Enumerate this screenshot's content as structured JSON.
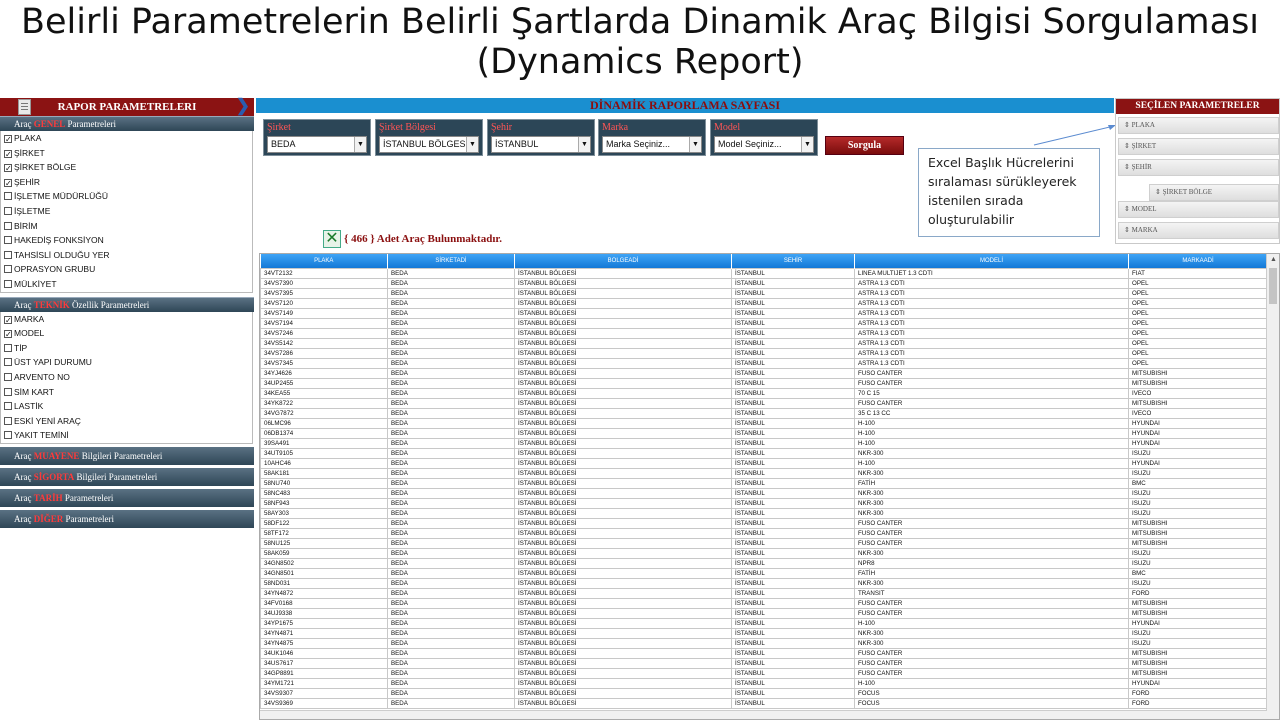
{
  "slide": {
    "title_line1": "Belirli Parametrelerin Belirli Şartlarda Dinamik Araç Bilgisi Sorgulaması",
    "title_line2": "(Dynamics Report)"
  },
  "sidebar": {
    "header": "RAPOR PARAMETRELERI",
    "sections": [
      {
        "prefix": "Araç",
        "highlight": "GENEL",
        "suffix": "Parametreleri",
        "items": [
          {
            "label": "PLAKA",
            "checked": true
          },
          {
            "label": "ŞİRKET",
            "checked": true
          },
          {
            "label": "ŞİRKET BÖLGE",
            "checked": true
          },
          {
            "label": "ŞEHİR",
            "checked": true
          },
          {
            "label": "İŞLETME MÜDÜRLÜĞÜ",
            "checked": false
          },
          {
            "label": "İŞLETME",
            "checked": false
          },
          {
            "label": "BİRİM",
            "checked": false
          },
          {
            "label": "HAKEDİŞ FONKSİYON",
            "checked": false
          },
          {
            "label": "TAHSİSLİ OLDUĞU YER",
            "checked": false
          },
          {
            "label": "OPRASYON GRUBU",
            "checked": false
          },
          {
            "label": "MÜLKİYET",
            "checked": false
          }
        ]
      },
      {
        "prefix": "Araç",
        "highlight": "TEKNİK",
        "suffix": "Özellik Parametreleri",
        "items": [
          {
            "label": "MARKA",
            "checked": true
          },
          {
            "label": "MODEL",
            "checked": true
          },
          {
            "label": "TİP",
            "checked": false
          },
          {
            "label": "ÜST YAPI DURUMU",
            "checked": false
          },
          {
            "label": "ARVENTO NO",
            "checked": false
          },
          {
            "label": "SİM KART",
            "checked": false
          },
          {
            "label": "LASTİK",
            "checked": false
          },
          {
            "label": "ESKİ YENİ ARAÇ",
            "checked": false
          },
          {
            "label": "YAKIT TEMİNİ",
            "checked": false
          }
        ]
      }
    ],
    "collapsed": [
      {
        "prefix": "Araç",
        "highlight": "MUAYENE",
        "suffix": "Bilgileri Parametreleri"
      },
      {
        "prefix": "Araç",
        "highlight": "SİGORTA",
        "suffix": "Bilgileri Parametreleri"
      },
      {
        "prefix": "Araç",
        "highlight": "TARİH",
        "suffix": "Parametreleri"
      },
      {
        "prefix": "Araç",
        "highlight": "DİĞER",
        "suffix": "Parametreleri"
      }
    ]
  },
  "main": {
    "header": "DİNAMİK RAPORLAMA SAYFASI",
    "filters": [
      {
        "label": "Şirket",
        "value": "BEDA"
      },
      {
        "label": "Şirket Bölgesi",
        "value": "İSTANBUL BÖLGESİ"
      },
      {
        "label": "Şehir",
        "value": "İSTANBUL"
      },
      {
        "label": "Marka",
        "value": "Marka Seçiniz..."
      },
      {
        "label": "Model",
        "value": "Model Seçiniz..."
      }
    ],
    "query_button": "Sorgula",
    "count_text": "{ 466 } Adet Araç Bulunmaktadır."
  },
  "callout": {
    "text": "Excel Başlık Hücrelerini sıralaması sürükleyerek istenilen sırada oluşturulabilir"
  },
  "selected_params": {
    "header": "SEÇİLEN PARAMETRELER",
    "items": [
      "PLAKA",
      "ŞİRKET",
      "ŞEHİR",
      "ŞİRKET BÖLGE",
      "MODEL",
      "MARKA"
    ]
  },
  "table": {
    "columns": [
      "PLAKA",
      "SİRKETADİ",
      "BOLGEADİ",
      "SEHİR",
      "MODELİ",
      "MARKAADİ"
    ],
    "rows": [
      [
        "34VT2132",
        "BEDA",
        "İSTANBUL BÖLGESİ",
        "İSTANBUL",
        "LINEA MULTIJET 1.3 CDTI",
        "FIAT"
      ],
      [
        "34VS7390",
        "BEDA",
        "İSTANBUL BÖLGESİ",
        "İSTANBUL",
        "ASTRA 1.3 CDTI",
        "OPEL"
      ],
      [
        "34VS7395",
        "BEDA",
        "İSTANBUL BÖLGESİ",
        "İSTANBUL",
        "ASTRA 1.3 CDTI",
        "OPEL"
      ],
      [
        "34VS7120",
        "BEDA",
        "İSTANBUL BÖLGESİ",
        "İSTANBUL",
        "ASTRA 1.3 CDTI",
        "OPEL"
      ],
      [
        "34VS7149",
        "BEDA",
        "İSTANBUL BÖLGESİ",
        "İSTANBUL",
        "ASTRA 1.3 CDTI",
        "OPEL"
      ],
      [
        "34VS7194",
        "BEDA",
        "İSTANBUL BÖLGESİ",
        "İSTANBUL",
        "ASTRA 1.3 CDTI",
        "OPEL"
      ],
      [
        "34VS7246",
        "BEDA",
        "İSTANBUL BÖLGESİ",
        "İSTANBUL",
        "ASTRA 1.3 CDTI",
        "OPEL"
      ],
      [
        "34VS5142",
        "BEDA",
        "İSTANBUL BÖLGESİ",
        "İSTANBUL",
        "ASTRA 1.3 CDTI",
        "OPEL"
      ],
      [
        "34VS7286",
        "BEDA",
        "İSTANBUL BÖLGESİ",
        "İSTANBUL",
        "ASTRA 1.3 CDTI",
        "OPEL"
      ],
      [
        "34VS7345",
        "BEDA",
        "İSTANBUL BÖLGESİ",
        "İSTANBUL",
        "ASTRA 1.3 CDTI",
        "OPEL"
      ],
      [
        "34YJ4626",
        "BEDA",
        "İSTANBUL BÖLGESİ",
        "İSTANBUL",
        "FUSO CANTER",
        "MITSUBISHI"
      ],
      [
        "34UP2455",
        "BEDA",
        "İSTANBUL BÖLGESİ",
        "İSTANBUL",
        "FUSO CANTER",
        "MITSUBISHI"
      ],
      [
        "34KEA55",
        "BEDA",
        "İSTANBUL BÖLGESİ",
        "İSTANBUL",
        "70 C 15",
        "IVECO"
      ],
      [
        "34YK8722",
        "BEDA",
        "İSTANBUL BÖLGESİ",
        "İSTANBUL",
        "FUSO CANTER",
        "MITSUBISHI"
      ],
      [
        "34VG7872",
        "BEDA",
        "İSTANBUL BÖLGESİ",
        "İSTANBUL",
        "35 C 13 CC",
        "IVECO"
      ],
      [
        "06LMC96",
        "BEDA",
        "İSTANBUL BÖLGESİ",
        "İSTANBUL",
        "H-100",
        "HYUNDAI"
      ],
      [
        "06DB1374",
        "BEDA",
        "İSTANBUL BÖLGESİ",
        "İSTANBUL",
        "H-100",
        "HYUNDAI"
      ],
      [
        "39SA491",
        "BEDA",
        "İSTANBUL BÖLGESİ",
        "İSTANBUL",
        "H-100",
        "HYUNDAI"
      ],
      [
        "34UT9105",
        "BEDA",
        "İSTANBUL BÖLGESİ",
        "İSTANBUL",
        "NKR-300",
        "ISUZU"
      ],
      [
        "10AHC46",
        "BEDA",
        "İSTANBUL BÖLGESİ",
        "İSTANBUL",
        "H-100",
        "HYUNDAI"
      ],
      [
        "58AK181",
        "BEDA",
        "İSTANBUL BÖLGESİ",
        "İSTANBUL",
        "NKR-300",
        "ISUZU"
      ],
      [
        "58NU740",
        "BEDA",
        "İSTANBUL BÖLGESİ",
        "İSTANBUL",
        "FATİH",
        "BMC"
      ],
      [
        "58NC483",
        "BEDA",
        "İSTANBUL BÖLGESİ",
        "İSTANBUL",
        "NKR-300",
        "ISUZU"
      ],
      [
        "58NF943",
        "BEDA",
        "İSTANBUL BÖLGESİ",
        "İSTANBUL",
        "NKR-300",
        "ISUZU"
      ],
      [
        "58AY303",
        "BEDA",
        "İSTANBUL BÖLGESİ",
        "İSTANBUL",
        "NKR-300",
        "ISUZU"
      ],
      [
        "58DF122",
        "BEDA",
        "İSTANBUL BÖLGESİ",
        "İSTANBUL",
        "FUSO CANTER",
        "MITSUBISHI"
      ],
      [
        "58TF172",
        "BEDA",
        "İSTANBUL BÖLGESİ",
        "İSTANBUL",
        "FUSO CANTER",
        "MITSUBISHI"
      ],
      [
        "58NU125",
        "BEDA",
        "İSTANBUL BÖLGESİ",
        "İSTANBUL",
        "FUSO CANTER",
        "MITSUBISHI"
      ],
      [
        "58AK059",
        "BEDA",
        "İSTANBUL BÖLGESİ",
        "İSTANBUL",
        "NKR-300",
        "ISUZU"
      ],
      [
        "34GN8502",
        "BEDA",
        "İSTANBUL BÖLGESİ",
        "İSTANBUL",
        "NPR8",
        "ISUZU"
      ],
      [
        "34GN8501",
        "BEDA",
        "İSTANBUL BÖLGESİ",
        "İSTANBUL",
        "FATİH",
        "BMC"
      ],
      [
        "58ND031",
        "BEDA",
        "İSTANBUL BÖLGESİ",
        "İSTANBUL",
        "NKR-300",
        "ISUZU"
      ],
      [
        "34YN4872",
        "BEDA",
        "İSTANBUL BÖLGESİ",
        "İSTANBUL",
        "TRANSIT",
        "FORD"
      ],
      [
        "34FV0168",
        "BEDA",
        "İSTANBUL BÖLGESİ",
        "İSTANBUL",
        "FUSO CANTER",
        "MITSUBISHI"
      ],
      [
        "34UJ9338",
        "BEDA",
        "İSTANBUL BÖLGESİ",
        "İSTANBUL",
        "FUSO CANTER",
        "MITSUBISHI"
      ],
      [
        "34YP1675",
        "BEDA",
        "İSTANBUL BÖLGESİ",
        "İSTANBUL",
        "H-100",
        "HYUNDAI"
      ],
      [
        "34YN4871",
        "BEDA",
        "İSTANBUL BÖLGESİ",
        "İSTANBUL",
        "NKR-300",
        "ISUZU"
      ],
      [
        "34YN4875",
        "BEDA",
        "İSTANBUL BÖLGESİ",
        "İSTANBUL",
        "NKR-300",
        "ISUZU"
      ],
      [
        "34UK1046",
        "BEDA",
        "İSTANBUL BÖLGESİ",
        "İSTANBUL",
        "FUSO CANTER",
        "MITSUBISHI"
      ],
      [
        "34US7617",
        "BEDA",
        "İSTANBUL BÖLGESİ",
        "İSTANBUL",
        "FUSO CANTER",
        "MITSUBISHI"
      ],
      [
        "34GP8891",
        "BEDA",
        "İSTANBUL BÖLGESİ",
        "İSTANBUL",
        "FUSO CANTER",
        "MITSUBISHI"
      ],
      [
        "34YM1721",
        "BEDA",
        "İSTANBUL BÖLGESİ",
        "İSTANBUL",
        "H-100",
        "HYUNDAI"
      ],
      [
        "34VS9307",
        "BEDA",
        "İSTANBUL BÖLGESİ",
        "İSTANBUL",
        "FOCUS",
        "FORD"
      ],
      [
        "34VS9369",
        "BEDA",
        "İSTANBUL BÖLGESİ",
        "İSTANBUL",
        "FOCUS",
        "FORD"
      ]
    ]
  }
}
